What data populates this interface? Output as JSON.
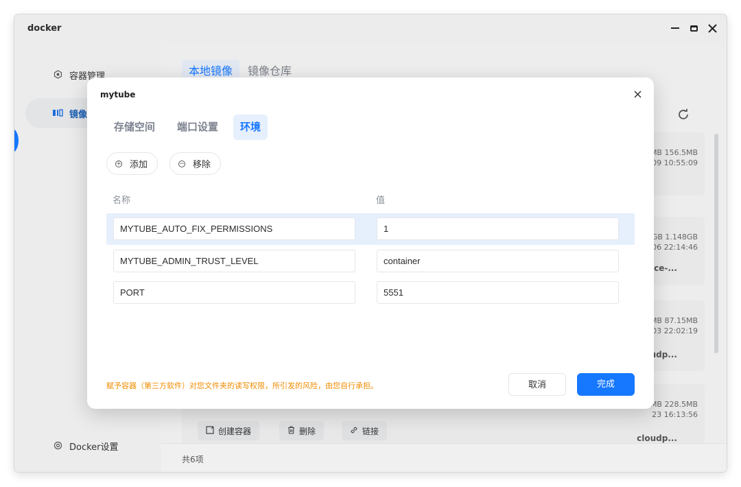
{
  "window": {
    "title": "docker"
  },
  "sidebar": {
    "items": [
      {
        "label": "容器管理",
        "icon": "container-icon"
      },
      {
        "label": "镜像",
        "icon": "image-icon"
      },
      {
        "label": "Docker设置",
        "icon": "settings-icon"
      }
    ]
  },
  "content": {
    "tabs": [
      {
        "label": "本地镜像",
        "active": true
      },
      {
        "label": "镜像仓库",
        "active": false
      }
    ],
    "cards": [
      {
        "meta1": "MB 156.5MB",
        "meta2": "09 10:55:09",
        "name": ""
      },
      {
        "meta1": "GB 1.148GB",
        "meta2": "06 22:14:46",
        "name": "ice-..."
      },
      {
        "meta1": "MB 87.15MB",
        "meta2": "03 22:02:19",
        "name": "oudp..."
      },
      {
        "meta1": "MB 228.5MB",
        "meta2": "23 16:13:56",
        "name": "cloudp..."
      }
    ],
    "card_actions": {
      "create": "创建容器",
      "delete": "删除",
      "link": "链接"
    },
    "footer_count": "共6项"
  },
  "modal": {
    "title": "mytube",
    "tabs": [
      {
        "label": "存储空间",
        "active": false
      },
      {
        "label": "端口设置",
        "active": false
      },
      {
        "label": "环境",
        "active": true
      }
    ],
    "add_label": "添加",
    "remove_label": "移除",
    "col_name": "名称",
    "col_value": "值",
    "env": [
      {
        "name": "MYTUBE_AUTO_FIX_PERMISSIONS",
        "value": "1",
        "selected": true
      },
      {
        "name": "MYTUBE_ADMIN_TRUST_LEVEL",
        "value": "container",
        "selected": false
      },
      {
        "name": "PORT",
        "value": "5551",
        "selected": false
      }
    ],
    "warning": "赋予容器（第三方软件）对您文件夹的读写权限，所引发的风险，由您自行承担。",
    "cancel_label": "取消",
    "ok_label": "完成"
  },
  "colors": {
    "accent": "#1677ff",
    "warning": "#f08c00",
    "selected_row": "#e6effc"
  }
}
